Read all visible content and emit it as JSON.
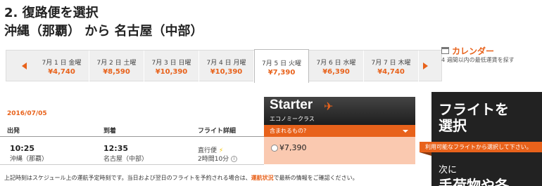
{
  "page": {
    "step_title": "2. 復路便を選択",
    "route_title": "沖縄（那覇） から 名古屋（中部）"
  },
  "date_strip": {
    "prev_icon": "triangle-left-icon",
    "next_icon": "triangle-right-icon",
    "dates": [
      {
        "label": "7月 1 日 金曜",
        "price": "¥4,740"
      },
      {
        "label": "7月 2 日 土曜",
        "price": "¥8,590"
      },
      {
        "label": "7月 3 日 日曜",
        "price": "¥10,390"
      },
      {
        "label": "7月 4 日 月曜",
        "price": "¥10,390"
      },
      {
        "label": "7月 5 日 火曜",
        "price": "¥7,390"
      },
      {
        "label": "7月 6 日 水曜",
        "price": "¥6,390"
      },
      {
        "label": "7月 7 日 木曜",
        "price": "¥4,740"
      }
    ],
    "selected_index": 4
  },
  "calendar_link": {
    "icon": "calendar-icon",
    "title": "カレンダー",
    "subtitle": "4 週間以内の最低運賃を探す"
  },
  "flights": {
    "date": "2016/07/05",
    "headers": {
      "depart": "出発",
      "arrive": "到着",
      "details": "フライト詳細"
    },
    "rows": [
      {
        "depart_time": "10:25",
        "depart_airport": "沖縄（那覇）",
        "arrive_time": "12:35",
        "arrive_airport": "名古屋（中部）",
        "flight_type": "直行便",
        "duration": "2時間10分"
      }
    ]
  },
  "fare_class": {
    "name": "Starter",
    "subtitle": "エコノミークラス",
    "includes_label": "含まれるもの?",
    "price": "¥7,390",
    "accent": "#e8621b"
  },
  "banner": {
    "headline_1": "フライトを",
    "headline_2": "選択",
    "tag": "利用可能なフライトから選択して下さい。",
    "next_label": "次に",
    "next_big": "手荷物や各"
  },
  "footer_note": {
    "before": "上記時刻はスケジュール上の運航予定時刻です。当日および翌日のフライトを予約される場合は、",
    "link": "運航状況",
    "after": "で最新の情報をご確認ください。"
  }
}
